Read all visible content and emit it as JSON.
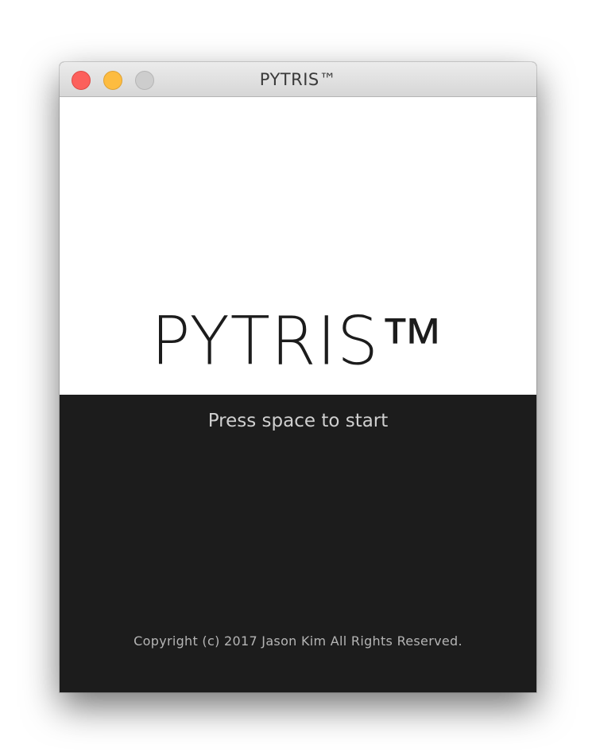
{
  "window": {
    "title": "PYTRIS™",
    "controls": {
      "close": "close-button",
      "minimize": "minimize-button",
      "zoom": "zoom-button"
    }
  },
  "start_screen": {
    "logo": "PYTRIS™",
    "prompt": "Press space to start",
    "copyright": "Copyright (c) 2017 Jason Kim All Rights Reserved."
  },
  "colors": {
    "background_light": "#ffffff",
    "background_dark": "#1c1c1c",
    "close": "#fc605c",
    "minimize": "#fdbc40",
    "zoom_disabled": "#cdcdcd"
  }
}
